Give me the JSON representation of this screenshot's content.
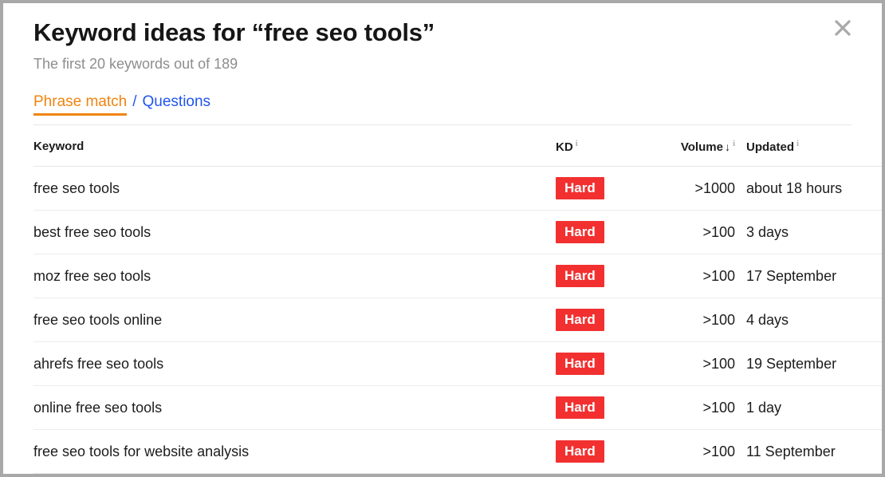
{
  "modal": {
    "title": "Keyword ideas for “free seo tools”",
    "subtitle": "The first 20 keywords out of 189",
    "close_label": "×",
    "close_icon": "close-icon"
  },
  "tabs": {
    "active": "Phrase match",
    "separator": "/",
    "inactive": "Questions"
  },
  "table": {
    "headers": {
      "keyword": "Keyword",
      "kd": "KD",
      "volume": "Volume",
      "sort_arrow": "↓",
      "updated": "Updated",
      "info_icon": "i"
    },
    "rows": [
      {
        "keyword": "free seo tools",
        "kd": "Hard",
        "volume": ">1000",
        "updated": "about 18 hours"
      },
      {
        "keyword": "best free seo tools",
        "kd": "Hard",
        "volume": ">100",
        "updated": "3 days"
      },
      {
        "keyword": "moz free seo tools",
        "kd": "Hard",
        "volume": ">100",
        "updated": "17 September"
      },
      {
        "keyword": "free seo tools online",
        "kd": "Hard",
        "volume": ">100",
        "updated": "4 days"
      },
      {
        "keyword": "ahrefs free seo tools",
        "kd": "Hard",
        "volume": ">100",
        "updated": "19 September"
      },
      {
        "keyword": "online free seo tools",
        "kd": "Hard",
        "volume": ">100",
        "updated": "1 day"
      },
      {
        "keyword": "free seo tools for website analysis",
        "kd": "Hard",
        "volume": ">100",
        "updated": "11 September"
      }
    ]
  },
  "colors": {
    "accent_orange": "#f08410",
    "link_blue": "#2255ee",
    "kd_hard_red": "#f23030",
    "subtitle_gray": "#8d8d8d",
    "border_gray": "#a8a8a8"
  }
}
